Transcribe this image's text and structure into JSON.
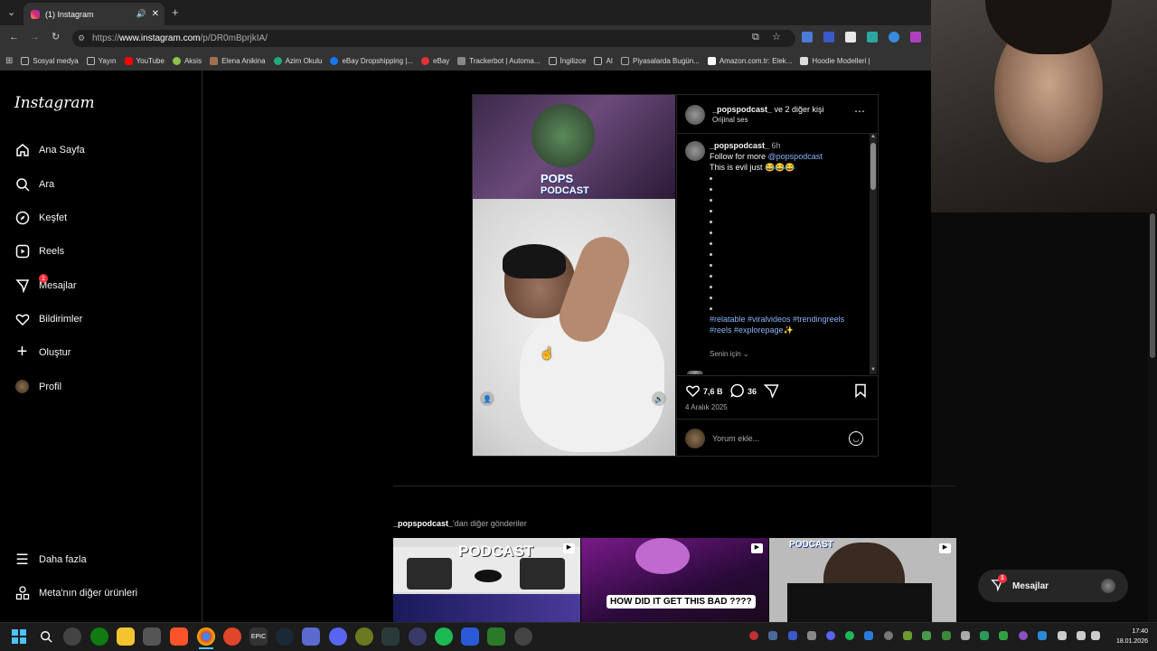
{
  "browser": {
    "tab_title": "(1) Instagram",
    "url_prefix": "https://",
    "url_domain": "www.instagram.com",
    "url_path": "/p/DR0mBprjkIA/",
    "bookmarks": [
      "Sosyal medya",
      "Yayın",
      "YouTube",
      "Aksis",
      "Elena Anikina",
      "Azim Okulu",
      "eBay Dropshipping |...",
      "eBay",
      "Trackerbot | Automa...",
      "İngilizce",
      "AI",
      "Piyasalarda Bugün...",
      "Amazon.com.tr: Elek...",
      "Hoodie Modelleri |"
    ]
  },
  "sidebar": {
    "logo": "Instagram",
    "items": [
      {
        "label": "Ana Sayfa",
        "icon": "home-icon"
      },
      {
        "label": "Ara",
        "icon": "search-icon"
      },
      {
        "label": "Keşfet",
        "icon": "compass-icon"
      },
      {
        "label": "Reels",
        "icon": "reels-icon"
      },
      {
        "label": "Mesajlar",
        "icon": "messenger-icon",
        "badge": "1"
      },
      {
        "label": "Bildirimler",
        "icon": "heart-icon"
      },
      {
        "label": "Oluştur",
        "icon": "plus-icon"
      },
      {
        "label": "Profil",
        "icon": "avatar"
      }
    ],
    "more": "Daha fazla",
    "meta": "Meta'nın diğer ürünleri"
  },
  "post": {
    "video_logo_line1": "POPS",
    "video_logo_line2": "PODCAST",
    "header_user": "_popspodcast_",
    "header_others": "ve 2 diğer kişi",
    "header_audio": "Orijinal ses",
    "caption_user": "_popspodcast_",
    "caption_time": "6h",
    "caption_line1": "Follow for more ",
    "caption_mention": "@popspodcast",
    "caption_line2": "This is evil just 😂😂😂",
    "hashtags_line1": "#relatable #viralvideos #trendingreels",
    "hashtags_line2": "#reels #explorepage✨",
    "for_you": "Senin için",
    "likes": "7,6 B",
    "comments": "36",
    "date": "4 Aralık 2025",
    "comment_placeholder": "Yorum ekle..."
  },
  "more_posts": {
    "user": "_popspodcast_",
    "suffix": "'dan diğer gönderiler",
    "thumb1_text": "PODCAST",
    "thumb2_text": "HOW DID IT GET THIS BAD ????",
    "thumb3_text": "PODCAST"
  },
  "messages_popup": {
    "label": "Mesajlar",
    "badge": "1"
  },
  "taskbar": {
    "time": "17:40",
    "date": "18.01.2026"
  }
}
